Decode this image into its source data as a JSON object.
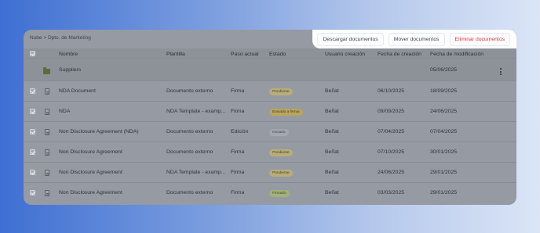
{
  "breadcrumb": "Nube > Dpto. de Marketing",
  "actions": {
    "download": "Descargar documentos",
    "move": "Mover documentos",
    "delete": "Eliminar documentos"
  },
  "columns": {
    "name": "Nombre",
    "template": "Plantilla",
    "step": "Paso actual",
    "status": "Estado",
    "user": "Usuario creación",
    "created": "Fecha de creación",
    "modified": "Fecha de modificación"
  },
  "folder": {
    "name": "Suppliers",
    "modified": "05/06/2025"
  },
  "rows": [
    {
      "name": "NDA Document",
      "template": "Documento externo",
      "step": "Firma",
      "status": "Pendiente",
      "user": "Beñat",
      "created": "06/10/2025",
      "modified": "18/09/2025"
    },
    {
      "name": "NDA",
      "template": "NDA Template - examp...",
      "step": "Firma",
      "status": "Enviado a firmar",
      "user": "Beñat",
      "created": "09/09/2025",
      "modified": "24/06/2025"
    },
    {
      "name": "Non Disclosure Agreement (NDA)",
      "template": "Documento externo",
      "step": "Edición",
      "status": "Iniciado",
      "user": "Beñat",
      "created": "07/04/2025",
      "modified": "07/04/2025"
    },
    {
      "name": "Non Disclosure Agreement",
      "template": "Documento externo",
      "step": "Firma",
      "status": "Pendiente",
      "user": "Beñat",
      "created": "07/10/2025",
      "modified": "30/01/2025"
    },
    {
      "name": "Non Disclosure Agreement",
      "template": "NDA Template - examp...",
      "step": "Firma",
      "status": "Pendiente",
      "user": "Beñat",
      "created": "24/06/2025",
      "modified": "29/01/2025"
    },
    {
      "name": "Non Disclosure Agreement",
      "template": "Documento externo",
      "step": "Firma",
      "status": "Firmado",
      "user": "Beñat",
      "created": "03/03/2025",
      "modified": "29/01/2025"
    }
  ],
  "status_colors": {
    "Pendiente": {
      "bg": "#b8ad7a",
      "fg": "#4a4426"
    },
    "Enviado a firmar": {
      "bg": "#b9a55c",
      "fg": "#4a3f18"
    },
    "Iniciado": {
      "bg": "#a3a8b0",
      "fg": "#40454d"
    },
    "Firmado": {
      "bg": "#a2b07c",
      "fg": "#3f4a25"
    }
  },
  "icons": {
    "folder": "folder-icon",
    "document": "document-icon",
    "more": "more-vertical-icon"
  }
}
